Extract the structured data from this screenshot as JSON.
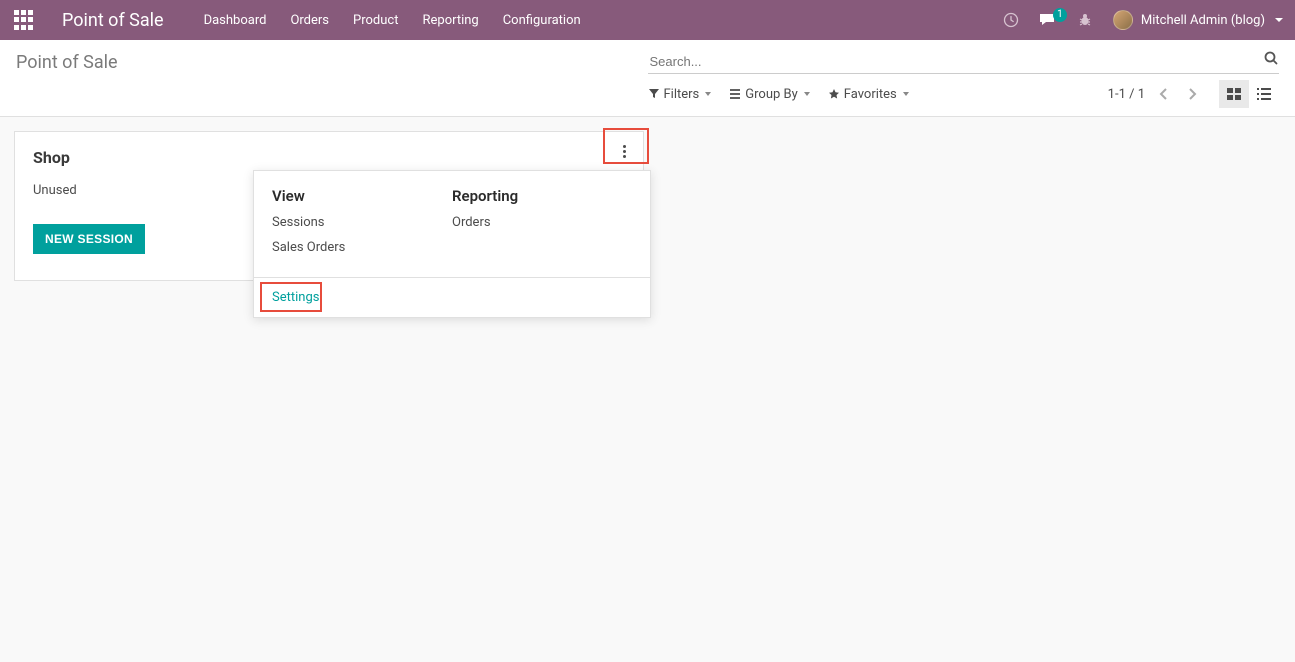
{
  "navbar": {
    "brand": "Point of Sale",
    "menu": [
      "Dashboard",
      "Orders",
      "Product",
      "Reporting",
      "Configuration"
    ],
    "messages_badge": "1",
    "user_name": "Mitchell Admin (blog)"
  },
  "control": {
    "breadcrumb": "Point of Sale",
    "search_placeholder": "Search...",
    "filters_label": "Filters",
    "groupby_label": "Group By",
    "favorites_label": "Favorites",
    "pager": "1-1 / 1"
  },
  "card": {
    "title": "Shop",
    "status": "Unused",
    "new_session_label": "NEW SESSION"
  },
  "popover": {
    "col1_header": "View",
    "col1_items": [
      "Sessions",
      "Sales Orders"
    ],
    "col2_header": "Reporting",
    "col2_items": [
      "Orders"
    ],
    "settings_label": "Settings"
  }
}
